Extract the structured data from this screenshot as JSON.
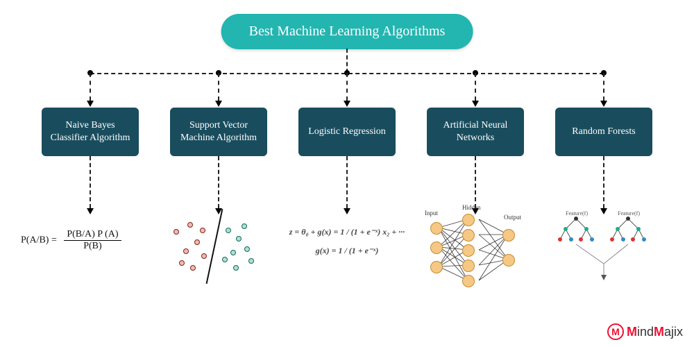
{
  "title": "Best Machine Learning Algorithms",
  "nodes": [
    {
      "key": "naive_bayes",
      "label": "Naive Bayes Classifier Algorithm"
    },
    {
      "key": "svm",
      "label": "Support Vector Machine Algorithm"
    },
    {
      "key": "logistic",
      "label": "Logistic Regression"
    },
    {
      "key": "ann",
      "label": "Artificial Neural Networks"
    },
    {
      "key": "rf",
      "label": "Random Forests"
    }
  ],
  "illustrations": {
    "naive_bayes": {
      "lhs": "P(A/B) =",
      "numerator": "P(B/A) P (A)",
      "denominator": "P(B)"
    },
    "logistic": {
      "line1": "z = θ₀ + g(x) = 1 / (1 + e⁻ˣ)   x₂ + ···",
      "line2": "g(x) = 1 / (1 + e⁻ˣ)"
    },
    "ann": {
      "layer_labels": [
        "Input",
        "Hidden",
        "Output"
      ]
    },
    "rf": {
      "feature_label": "Feature(f)"
    }
  },
  "branding": {
    "logo_text": "MindMajix",
    "logo_glyph": "M"
  },
  "colors": {
    "title_bg": "#23b5b0",
    "node_bg": "#194d5e",
    "accent_red": "#e01133"
  }
}
